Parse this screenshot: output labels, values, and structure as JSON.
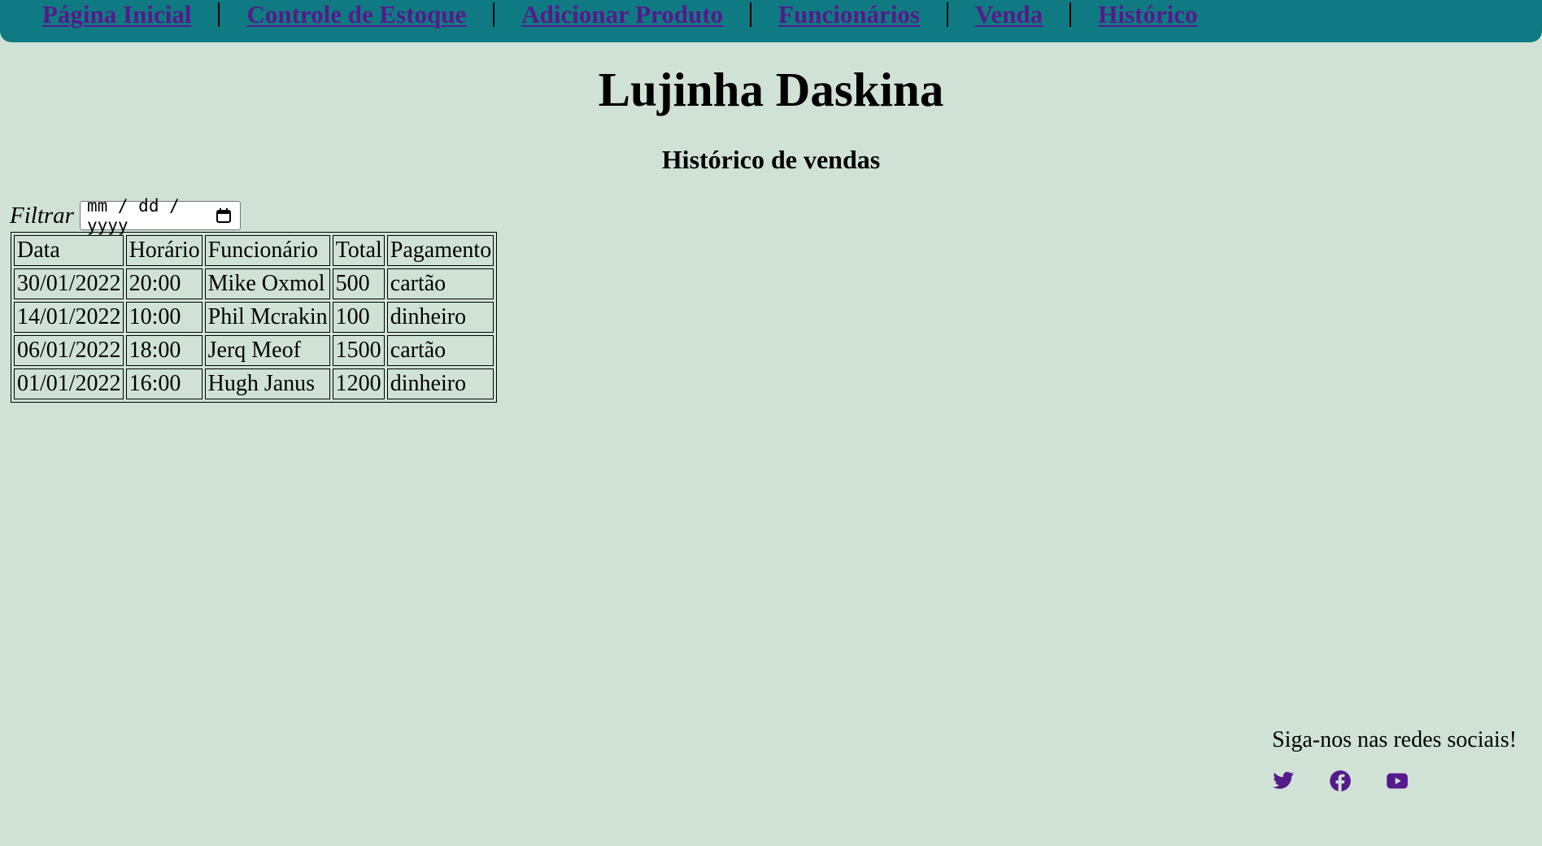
{
  "nav": {
    "items": [
      {
        "label": "Página Inicial"
      },
      {
        "label": "Controle de Estoque"
      },
      {
        "label": "Adicionar Produto"
      },
      {
        "label": "Funcionários"
      },
      {
        "label": "Venda"
      },
      {
        "label": "Histórico"
      }
    ]
  },
  "header": {
    "site_title": "Lujinha Daskina",
    "section_title": "Histórico de vendas"
  },
  "filter": {
    "label": "Filtrar",
    "date_placeholder": "mm / dd / yyyy"
  },
  "table": {
    "headers": [
      "Data",
      "Horário",
      "Funcionário",
      "Total",
      "Pagamento"
    ],
    "rows": [
      [
        "30/01/2022",
        "20:00",
        "Mike Oxmol",
        "500",
        "cartão"
      ],
      [
        "14/01/2022",
        "10:00",
        "Phil Mcrakin",
        "100",
        "dinheiro"
      ],
      [
        "06/01/2022",
        "18:00",
        "Jerq Meof",
        "1500",
        "cartão"
      ],
      [
        "01/01/2022",
        "16:00",
        "Hugh Janus",
        "1200",
        "dinheiro"
      ]
    ]
  },
  "footer": {
    "text": "Siga-nos nas redes sociais!",
    "social_icons": [
      "twitter-icon",
      "facebook-icon",
      "youtube-icon"
    ]
  },
  "colors": {
    "background": "#d0e2d6",
    "navbar": "#0f7a82",
    "link": "#551a8b"
  }
}
